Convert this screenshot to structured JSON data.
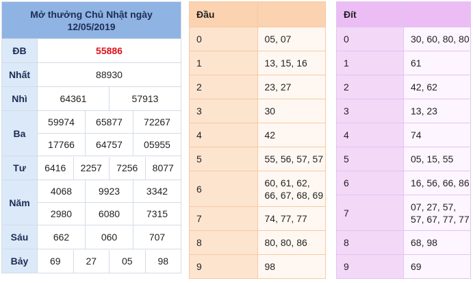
{
  "results": {
    "title_line1": "Mở thưởng Chủ Nhật ngày",
    "title_line2": "12/05/2019",
    "prizes": {
      "db": {
        "label": "ĐB",
        "values": [
          "55886"
        ]
      },
      "nhat": {
        "label": "Nhất",
        "values": [
          "88930"
        ]
      },
      "nhi": {
        "label": "Nhì",
        "values": [
          "64361",
          "57913"
        ]
      },
      "ba": {
        "label": "Ba",
        "values": [
          "59974",
          "65877",
          "72267",
          "17766",
          "64757",
          "05955"
        ]
      },
      "tu": {
        "label": "Tư",
        "values": [
          "6416",
          "2257",
          "7256",
          "8077"
        ]
      },
      "nam": {
        "label": "Năm",
        "values": [
          "4068",
          "9923",
          "3342",
          "2980",
          "6080",
          "7315"
        ]
      },
      "sau": {
        "label": "Sáu",
        "values": [
          "662",
          "060",
          "707"
        ]
      },
      "bay": {
        "label": "Bảy",
        "values": [
          "69",
          "27",
          "05",
          "98"
        ]
      }
    }
  },
  "dau": {
    "header": "Đầu",
    "rows": [
      {
        "k": "0",
        "v": "05, 07"
      },
      {
        "k": "1",
        "v": "13, 15, 16"
      },
      {
        "k": "2",
        "v": "23, 27"
      },
      {
        "k": "3",
        "v": "30"
      },
      {
        "k": "4",
        "v": "42"
      },
      {
        "k": "5",
        "v": "55, 56, 57, 57"
      },
      {
        "k": "6",
        "v": "60, 61, 62, 66, 67, 68, 69"
      },
      {
        "k": "7",
        "v": "74, 77, 77"
      },
      {
        "k": "8",
        "v": "80, 80, 86"
      },
      {
        "k": "9",
        "v": "98"
      }
    ]
  },
  "dit": {
    "header": "Đít",
    "rows": [
      {
        "k": "0",
        "v": "30, 60, 80, 80"
      },
      {
        "k": "1",
        "v": "61"
      },
      {
        "k": "2",
        "v": "42, 62"
      },
      {
        "k": "3",
        "v": "13, 23"
      },
      {
        "k": "4",
        "v": "74"
      },
      {
        "k": "5",
        "v": "05, 15, 55"
      },
      {
        "k": "6",
        "v": "16, 56, 66, 86"
      },
      {
        "k": "7",
        "v": "07, 27, 57, 57, 67, 77, 77"
      },
      {
        "k": "8",
        "v": "68, 98"
      },
      {
        "k": "9",
        "v": "69"
      }
    ]
  },
  "colors": {
    "special_prize": "#e0101a",
    "results_header": "#8fb3e3",
    "dau_header": "#fbd3b1",
    "dit_header": "#ecbdf5"
  }
}
